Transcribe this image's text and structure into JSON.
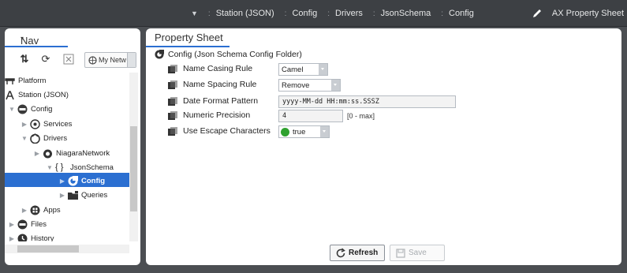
{
  "topbar": {
    "crumbs": [
      "Station (JSON)",
      "Config",
      "Drivers",
      "JsonSchema",
      "Config"
    ],
    "view_name": "AX Property Sheet",
    "pen_icon": "pencil-icon"
  },
  "nav": {
    "tab_label": "Nav",
    "network_select": "My Netw",
    "toolbar_icons": [
      "sync-arrows-icon",
      "refresh-icon",
      "close-icon"
    ],
    "tree": [
      {
        "label": "Platform",
        "icon": "platform-icon"
      },
      {
        "label": "Station (JSON)",
        "icon": "station-icon"
      },
      {
        "label": "Config",
        "icon": "config-db-icon"
      },
      {
        "label": "Services",
        "icon": "services-icon"
      },
      {
        "label": "Drivers",
        "icon": "drivers-icon"
      },
      {
        "label": "NiagaraNetwork",
        "icon": "niagara-network-icon"
      },
      {
        "label": "JsonSchema",
        "icon": "json-braces-icon"
      },
      {
        "label": "Config",
        "icon": "config-gear-icon"
      },
      {
        "label": "Queries",
        "icon": "folder-icon"
      },
      {
        "label": "Apps",
        "icon": "apps-icon"
      },
      {
        "label": "Files",
        "icon": "files-icon"
      },
      {
        "label": "History",
        "icon": "history-icon"
      }
    ]
  },
  "sheet": {
    "tab_label": "Property Sheet",
    "header": "Config  (Json Schema Config Folder)",
    "rows": [
      {
        "label": "Name Casing Rule",
        "value": "Camel"
      },
      {
        "label": "Name Spacing Rule",
        "value": "Remove"
      },
      {
        "label": "Date Format Pattern",
        "value": "yyyy-MM-dd HH:mm:ss.SSSZ"
      },
      {
        "label": "Numeric Precision",
        "value": "4",
        "range": "[0 - max]"
      },
      {
        "label": "Use Escape Characters",
        "value": "true"
      }
    ],
    "refresh_label": "Refresh",
    "save_label": "Save"
  },
  "colors": {
    "accent": "#2b6fd1",
    "topbar_bg": "#3d4044",
    "frame_bg": "#4b4e52",
    "true_dot": "#2fa12f"
  }
}
